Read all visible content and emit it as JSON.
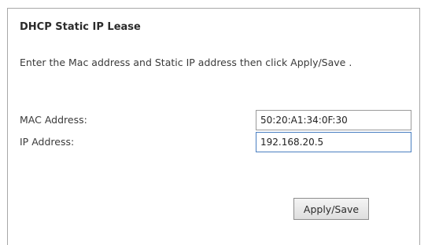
{
  "title": "DHCP Static IP Lease",
  "instructions": "Enter the Mac address and Static IP address then click Apply/Save .",
  "form": {
    "mac_label": "MAC Address:",
    "mac_value": "50:20:A1:34:0F:30",
    "ip_label": "IP Address:",
    "ip_value": "192.168.20.5"
  },
  "apply_label": "Apply/Save",
  "colors": {
    "focused_input_border": "#4a7fc1",
    "panel_border": "#a8a8a8"
  }
}
